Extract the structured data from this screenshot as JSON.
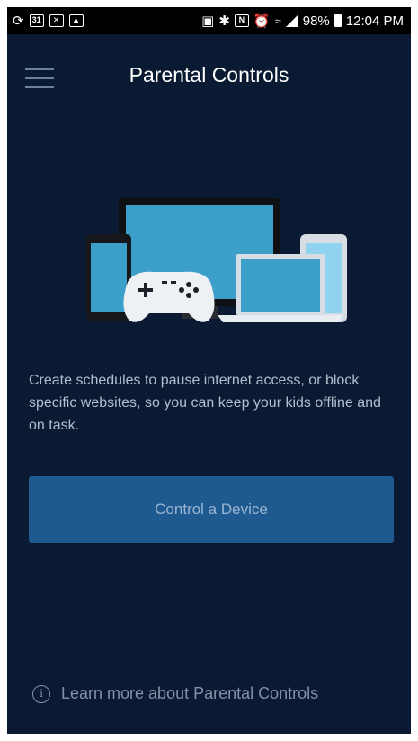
{
  "status_bar": {
    "notification_icons": [
      "cast-icon",
      "calendar-icon",
      "mail-icon",
      "photo-icon"
    ],
    "calendar_day": "31",
    "battery": "98%",
    "time": "12:04 PM"
  },
  "header": {
    "title": "Parental Controls",
    "menu_icon": "hamburger-menu-icon"
  },
  "illustration": {
    "devices": [
      "phone",
      "monitor",
      "game-controller",
      "laptop",
      "tablet"
    ]
  },
  "main": {
    "description": "Create schedules to pause internet access, or block specific websites, so you can keep your kids offline and on task.",
    "control_button_label": "Control a Device"
  },
  "footer": {
    "learn_more_label": "Learn more about Parental Controls",
    "info_icon": "info-icon"
  },
  "colors": {
    "background": "#0b1a33",
    "button": "#1e5a8f",
    "button_text": "#9ab5d1",
    "description_text": "#b4bdcc",
    "footer_text": "#8391a8"
  }
}
